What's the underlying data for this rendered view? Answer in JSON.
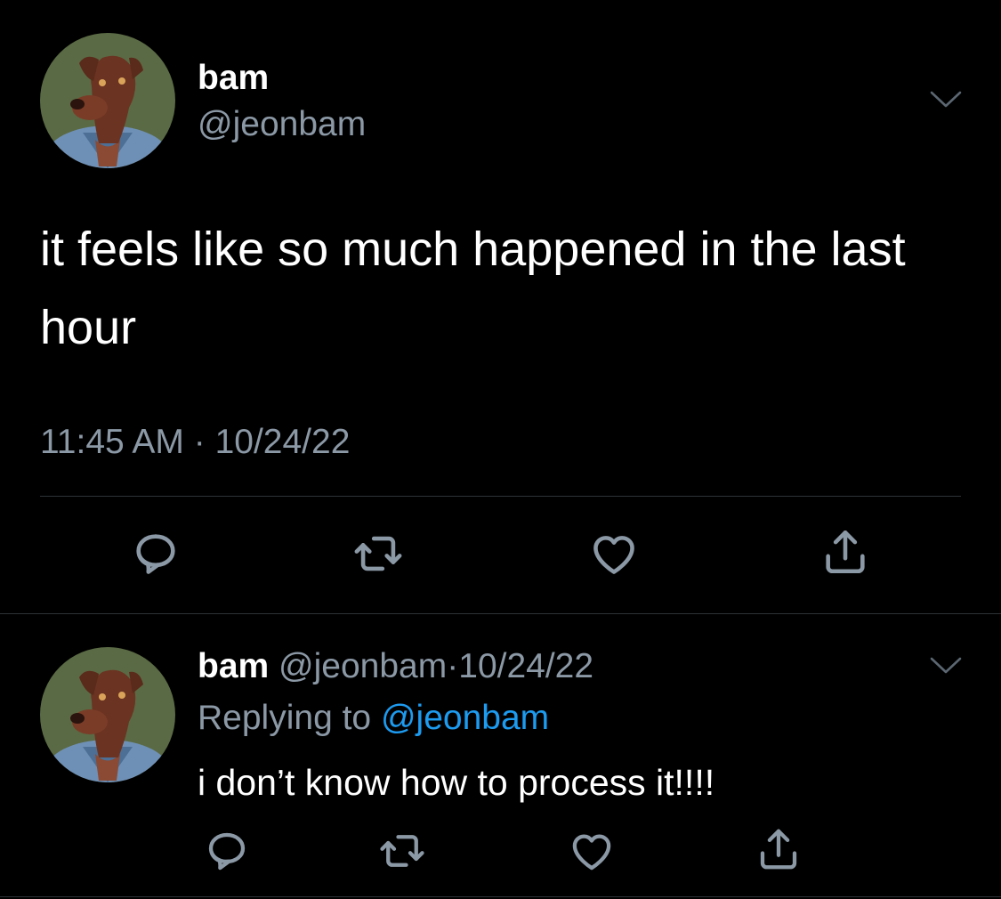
{
  "main_tweet": {
    "author_name": "bam",
    "author_handle": "@jeonbam",
    "text": "it feels like so much happened in the last hour",
    "time": "11:45 AM",
    "separator": "·",
    "date": "10/24/22",
    "actions": [
      "reply-icon",
      "retweet-icon",
      "like-icon",
      "share-icon"
    ]
  },
  "reply_tweet": {
    "author_name": "bam",
    "author_handle": "@jeonbam",
    "separator": "·",
    "date": "10/24/22",
    "replying_prefix": "Replying to",
    "replying_handle": "@jeonbam",
    "text": "i don’t know how to process it!!!!",
    "actions": [
      "reply-icon",
      "retweet-icon",
      "like-icon",
      "share-icon"
    ]
  },
  "colors": {
    "background": "#000000",
    "primary_text": "#ffffff",
    "secondary_text": "#8b98a5",
    "mention": "#1d9bf0",
    "divider": "#2f3336",
    "icon": "#8b98a5"
  }
}
